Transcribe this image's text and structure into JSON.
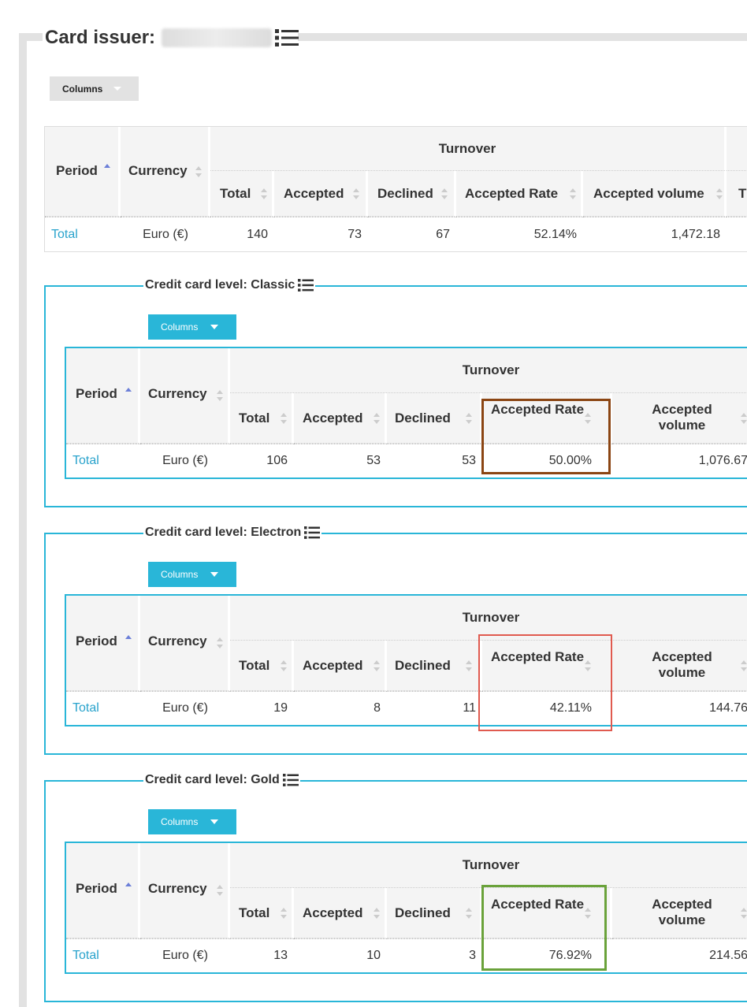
{
  "issuer": {
    "title": "Card issuer:"
  },
  "overall": {
    "columns_label": "Columns",
    "headers": {
      "period": "Period",
      "currency": "Currency",
      "group": "Turnover",
      "total": "Total",
      "accepted": "Accepted",
      "declined": "Declined",
      "accepted_rate": "Accepted Rate",
      "accepted_volume": "Accepted volume",
      "cut": "T"
    },
    "row": {
      "period": "Total",
      "currency": "Euro (€)",
      "total": "140",
      "accepted": "73",
      "declined": "67",
      "accepted_rate": "52.14%",
      "accepted_volume": "1,472.18"
    }
  },
  "sections": [
    {
      "title": "Credit card level: Classic",
      "columns_label": "Columns",
      "headers": {
        "period": "Period",
        "currency": "Currency",
        "group": "Turnover",
        "total": "Total",
        "accepted": "Accepted",
        "declined": "Declined",
        "accepted_rate": "Accepted Rate",
        "accepted_volume": "Accepted volume"
      },
      "row": {
        "period": "Total",
        "currency": "Euro (€)",
        "total": "106",
        "accepted": "53",
        "declined": "53",
        "accepted_rate": "50.00%",
        "accepted_volume": "1,076.67"
      },
      "highlight_color": "#8b4513"
    },
    {
      "title": "Credit card level: Electron",
      "columns_label": "Columns",
      "headers": {
        "period": "Period",
        "currency": "Currency",
        "group": "Turnover",
        "total": "Total",
        "accepted": "Accepted",
        "declined": "Declined",
        "accepted_rate": "Accepted Rate",
        "accepted_volume": "Accepted volume"
      },
      "row": {
        "period": "Total",
        "currency": "Euro (€)",
        "total": "19",
        "accepted": "8",
        "declined": "11",
        "accepted_rate": "42.11%",
        "accepted_volume": "144.76"
      },
      "highlight_color": "#e05a4f"
    },
    {
      "title": "Credit card level: Gold",
      "columns_label": "Columns",
      "headers": {
        "period": "Period",
        "currency": "Currency",
        "group": "Turnover",
        "total": "Total",
        "accepted": "Accepted",
        "declined": "Declined",
        "accepted_rate": "Accepted Rate",
        "accepted_volume": "Accepted volume"
      },
      "row": {
        "period": "Total",
        "currency": "Euro (€)",
        "total": "13",
        "accepted": "10",
        "declined": "3",
        "accepted_rate": "76.92%",
        "accepted_volume": "214.56"
      },
      "highlight_color": "#6aa23a"
    }
  ],
  "colors": {
    "accent": "#29b6d8",
    "link": "#29a3cc",
    "frame_grey": "#e2e2e2"
  }
}
